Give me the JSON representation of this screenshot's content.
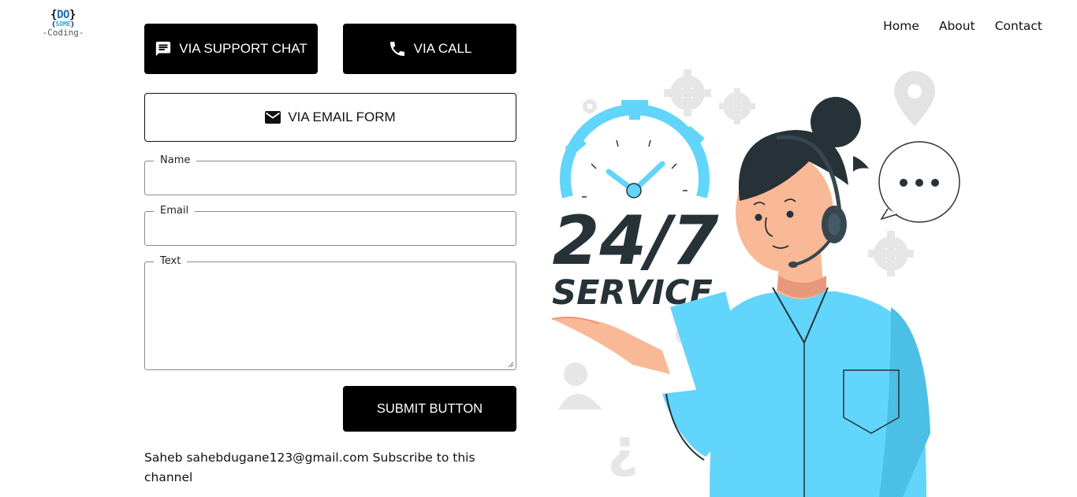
{
  "logo": {
    "line1": "DO",
    "line2": "SOME",
    "line3": "-Coding-"
  },
  "nav": {
    "items": [
      "Home",
      "About",
      "Contact"
    ]
  },
  "buttons": {
    "support_chat": "VIA SUPPORT CHAT",
    "call": "VIA CALL",
    "email_form": "VIA EMAIL FORM",
    "submit": "SUBMIT BUTTON"
  },
  "form": {
    "name_label": "Name",
    "email_label": "Email",
    "text_label": "Text",
    "name_value": "",
    "email_value": "",
    "text_value": ""
  },
  "footer": {
    "text": "Saheb sahebdugane123@gmail.com Subscribe to this channel"
  },
  "illustration": {
    "headline": "24/7",
    "subheadline": "SERVICE"
  },
  "colors": {
    "accent": "#61d5fb",
    "dark": "#263238",
    "skin": "#f9b896",
    "button": "#000000"
  },
  "icons": [
    "chat-icon",
    "phone-icon",
    "mail-icon"
  ]
}
